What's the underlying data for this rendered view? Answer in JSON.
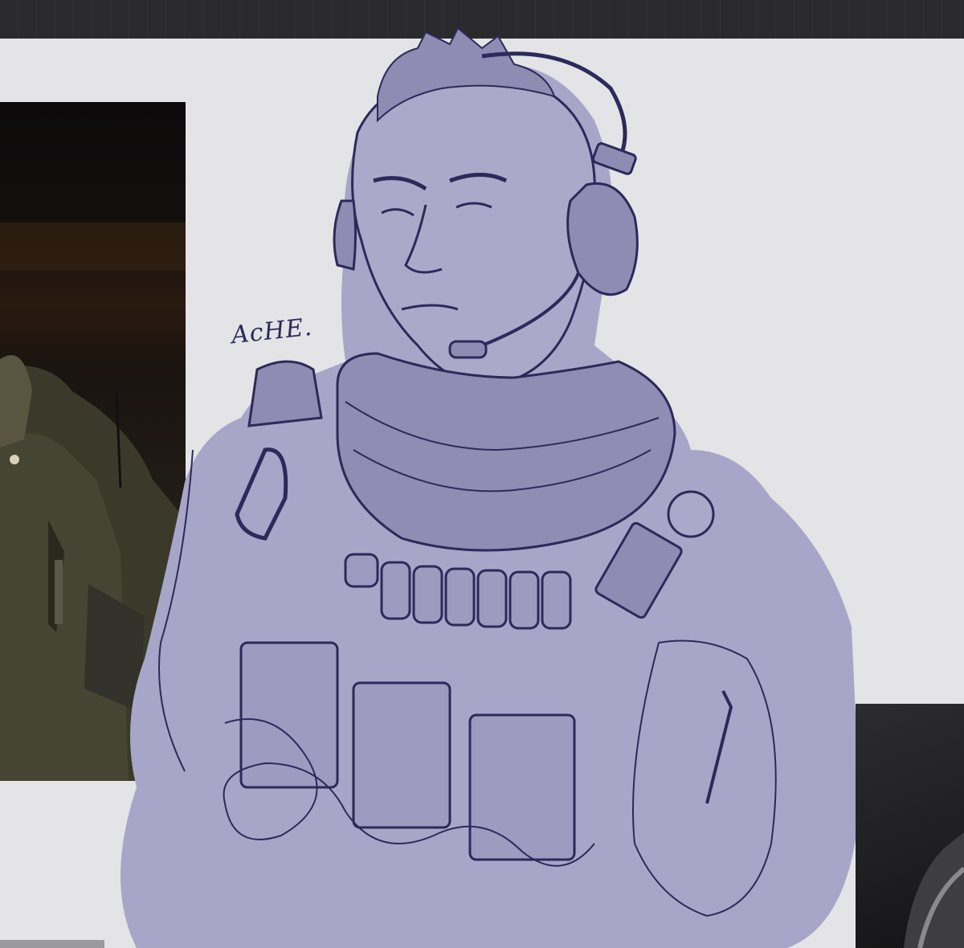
{
  "signature": {
    "text": "AcHE."
  },
  "colors": {
    "toolbar": "#2a2a2c",
    "canvas": "#e4e4e7",
    "sketch_fill": "#a8a6c8",
    "sketch_line": "#2b2a5a"
  },
  "icons": [
    "reference-photo-soldier",
    "reference-photo-dark"
  ]
}
